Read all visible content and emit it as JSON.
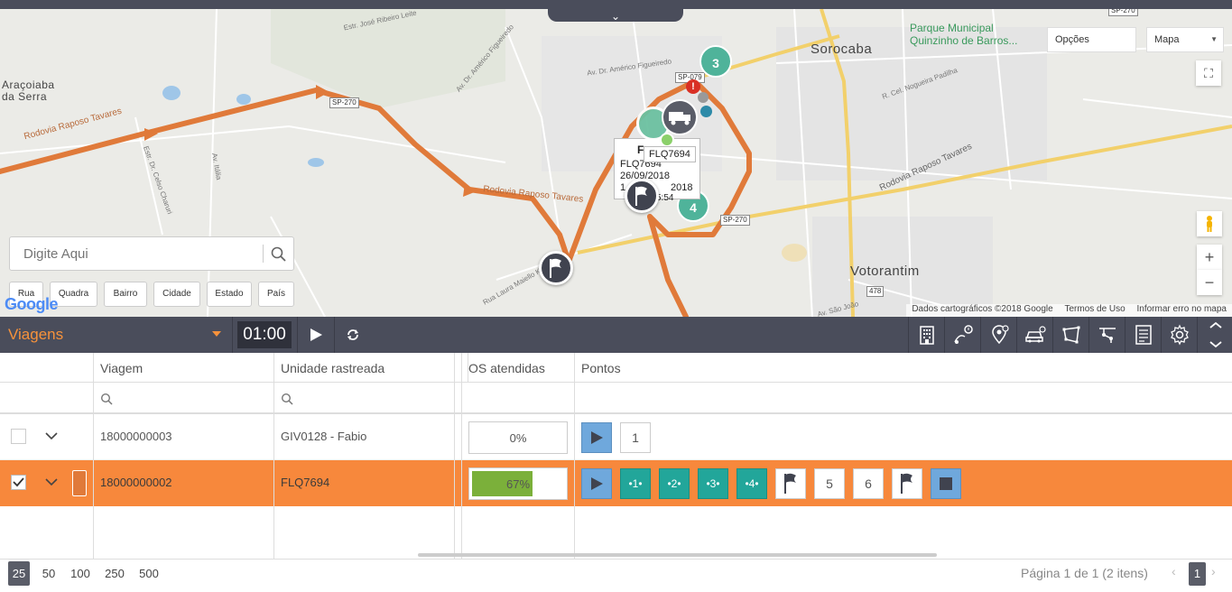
{
  "map": {
    "collapse_glyph": "⌄",
    "options_label": "Opções",
    "map_type": "Mapa",
    "labels": {
      "aracoiaba": "Araçoiaba\nda Serra",
      "sorocaba": "Sorocaba",
      "votorantim": "Votorantim",
      "park": "Parque Municipal\nQuinzinho de Barros...",
      "rodovia_raposo_1": "Rodovia Raposo Tavares",
      "rodovia_raposo_2": "Rodovia Raposo Tavares",
      "rodovia_raposo_3": "Rodovia Raposo Tavares",
      "estr_jose_ribeiro": "Estr. José Ribeiro Leite",
      "av_americo": "Av. Dr. Américo Figueiredo",
      "av_americo_2": "Av. Dr. Américo Figueiredo",
      "r_cel_nogueira": "R. Cel. Nogueira Padilha",
      "estr_celso": "Estr. Dr. Celso Charuri",
      "av_italia": "Av. Itália",
      "r_laura": "Rua Laura Maiello Kook",
      "av_sao_joao": "Av. São João",
      "sp270_a": "SP-270",
      "sp270_b": "SP-270",
      "sp270_c": "SP-270",
      "sp079": "SP-079",
      "r478": "478"
    },
    "markers": {
      "cluster_3": "3",
      "cluster_4": "4",
      "tooltip_plate": "FLQ7694",
      "popup_line1": "FLQ7694",
      "popup_line2": "26/09/2018",
      "popup_line3": "1",
      "popup_line3b": "2018",
      "popup_initial": "F",
      "popup_time": "5:54"
    },
    "search": {
      "placeholder": "Digite Aqui"
    },
    "level_buttons": [
      "Rua",
      "Quadra",
      "Bairro",
      "Cidade",
      "Estado",
      "País"
    ],
    "google": "Google",
    "attribution": {
      "data": "Dados cartográficos ©2018 Google",
      "terms": "Termos de Uso",
      "report": "Informar erro no mapa"
    },
    "zoom_in": "+",
    "zoom_out": "−"
  },
  "toolbar": {
    "view": "Viagens",
    "timer": "01:00",
    "icons": [
      "building-icon",
      "route-alert-icon",
      "poi-alert-icon",
      "vehicle-icon",
      "polygon-icon",
      "route-icon",
      "report-icon",
      "settings-icon"
    ]
  },
  "grid": {
    "columns": [
      "Viagem",
      "Unidade rastreada",
      "OS atendidas",
      "Pontos"
    ],
    "rows": [
      {
        "viagem": "18000000003",
        "unidade": "GIV0128 - Fabio",
        "os_percent": "0%",
        "os_fraction": 0,
        "pontos": [
          "1"
        ]
      },
      {
        "viagem": "18000000002",
        "unidade": "FLQ7694",
        "os_percent": "67%",
        "os_fraction": 0.67,
        "pontos": [
          "1",
          "2",
          "3",
          "4",
          "5",
          "6"
        ]
      }
    ]
  },
  "pager": {
    "sizes": [
      "25",
      "50",
      "100",
      "250",
      "500"
    ],
    "info": "Página 1 de 1 (2 itens)",
    "prev": "‹",
    "current": "1",
    "next": "›"
  },
  "colors": {
    "accent": "#f7883c",
    "toolbar_bg": "#4a4d5b",
    "teal": "#22a69a",
    "route": "#e07a3a",
    "progress": "#7bb03a"
  }
}
